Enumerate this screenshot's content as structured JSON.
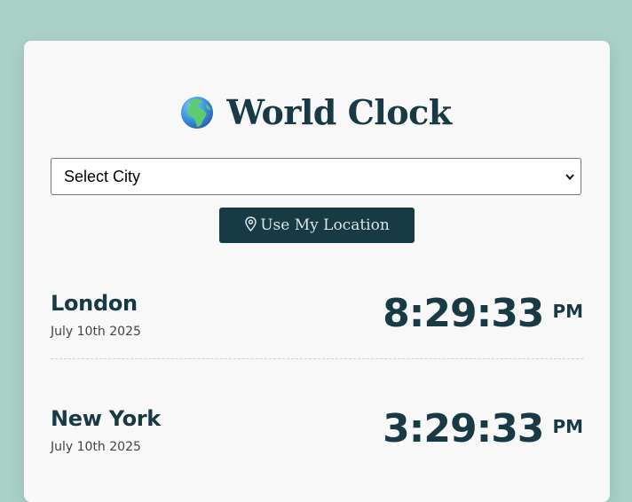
{
  "header": {
    "title": "World Clock",
    "globe_icon": "globe-europe-africa-icon"
  },
  "controls": {
    "city_select_value": "Select City",
    "location_button_label": "Use My Location",
    "location_icon": "map-pin-icon"
  },
  "clocks": [
    {
      "city": "London",
      "date": "July 10th 2025",
      "time": "8:29:33",
      "period": "PM"
    },
    {
      "city": "New York",
      "date": "July 10th 2025",
      "time": "3:29:33",
      "period": "PM"
    }
  ],
  "colors": {
    "background": "#aad0c8",
    "card": "#f8f8f8",
    "primary": "#183a45"
  }
}
